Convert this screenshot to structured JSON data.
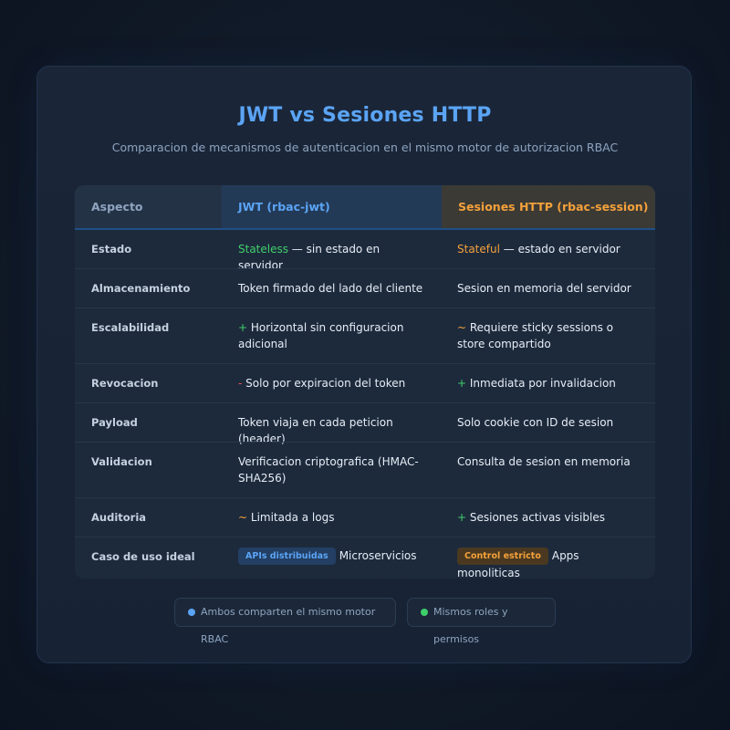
{
  "title": "JWT vs Sesiones HTTP",
  "subtitle": "Comparacion de mecanismos de autenticacion en el mismo motor de autorizacion RBAC",
  "colors": {
    "accent_blue": "#5ba4f5",
    "accent_orange": "#f5a13b",
    "positive_green": "#3fcf6a",
    "negative_red": "#ef5350"
  },
  "table": {
    "headers": {
      "aspect": "Aspecto",
      "jwt": "JWT (rbac-jwt)",
      "session": "Sesiones HTTP (rbac-session)"
    },
    "rows": [
      {
        "aspect": "Estado",
        "jwt": {
          "highlight": "Stateless",
          "text": " — sin estado en servidor"
        },
        "session": {
          "highlight": "Stateful",
          "text": " — estado en servidor"
        }
      },
      {
        "aspect": "Almacenamiento",
        "jwt": {
          "text": "Token firmado del lado del cliente"
        },
        "session": {
          "text": "Sesion en memoria del servidor"
        }
      },
      {
        "aspect": "Escalabilidad",
        "jwt": {
          "symbol": "+",
          "text": " Horizontal sin configuracion adicional"
        },
        "session": {
          "symbol": "~",
          "text": " Requiere sticky sessions o store compartido"
        }
      },
      {
        "aspect": "Revocacion",
        "jwt": {
          "symbol": "-",
          "text": " Solo por expiracion del token"
        },
        "session": {
          "symbol": "+",
          "text": " Inmediata por invalidacion"
        }
      },
      {
        "aspect": "Payload",
        "jwt": {
          "text": "Token viaja en cada peticion (header)"
        },
        "session": {
          "text": "Solo cookie con ID de sesion"
        }
      },
      {
        "aspect": "Validacion",
        "jwt": {
          "text": "Verificacion criptografica (HMAC-SHA256)"
        },
        "session": {
          "text": "Consulta de sesion en memoria"
        }
      },
      {
        "aspect": "Auditoria",
        "jwt": {
          "symbol": "~",
          "text": " Limitada a logs"
        },
        "session": {
          "symbol": "+",
          "text": " Sesiones activas visibles"
        }
      },
      {
        "aspect": "Caso de uso ideal",
        "jwt": {
          "tag": "APIs distribuidas",
          "text": "Microservicios"
        },
        "session": {
          "tag": "Control estricto",
          "text": "Apps monoliticas"
        }
      }
    ]
  },
  "footer": {
    "left": "Ambos comparten el mismo motor RBAC",
    "right": "Mismos roles y permisos"
  }
}
